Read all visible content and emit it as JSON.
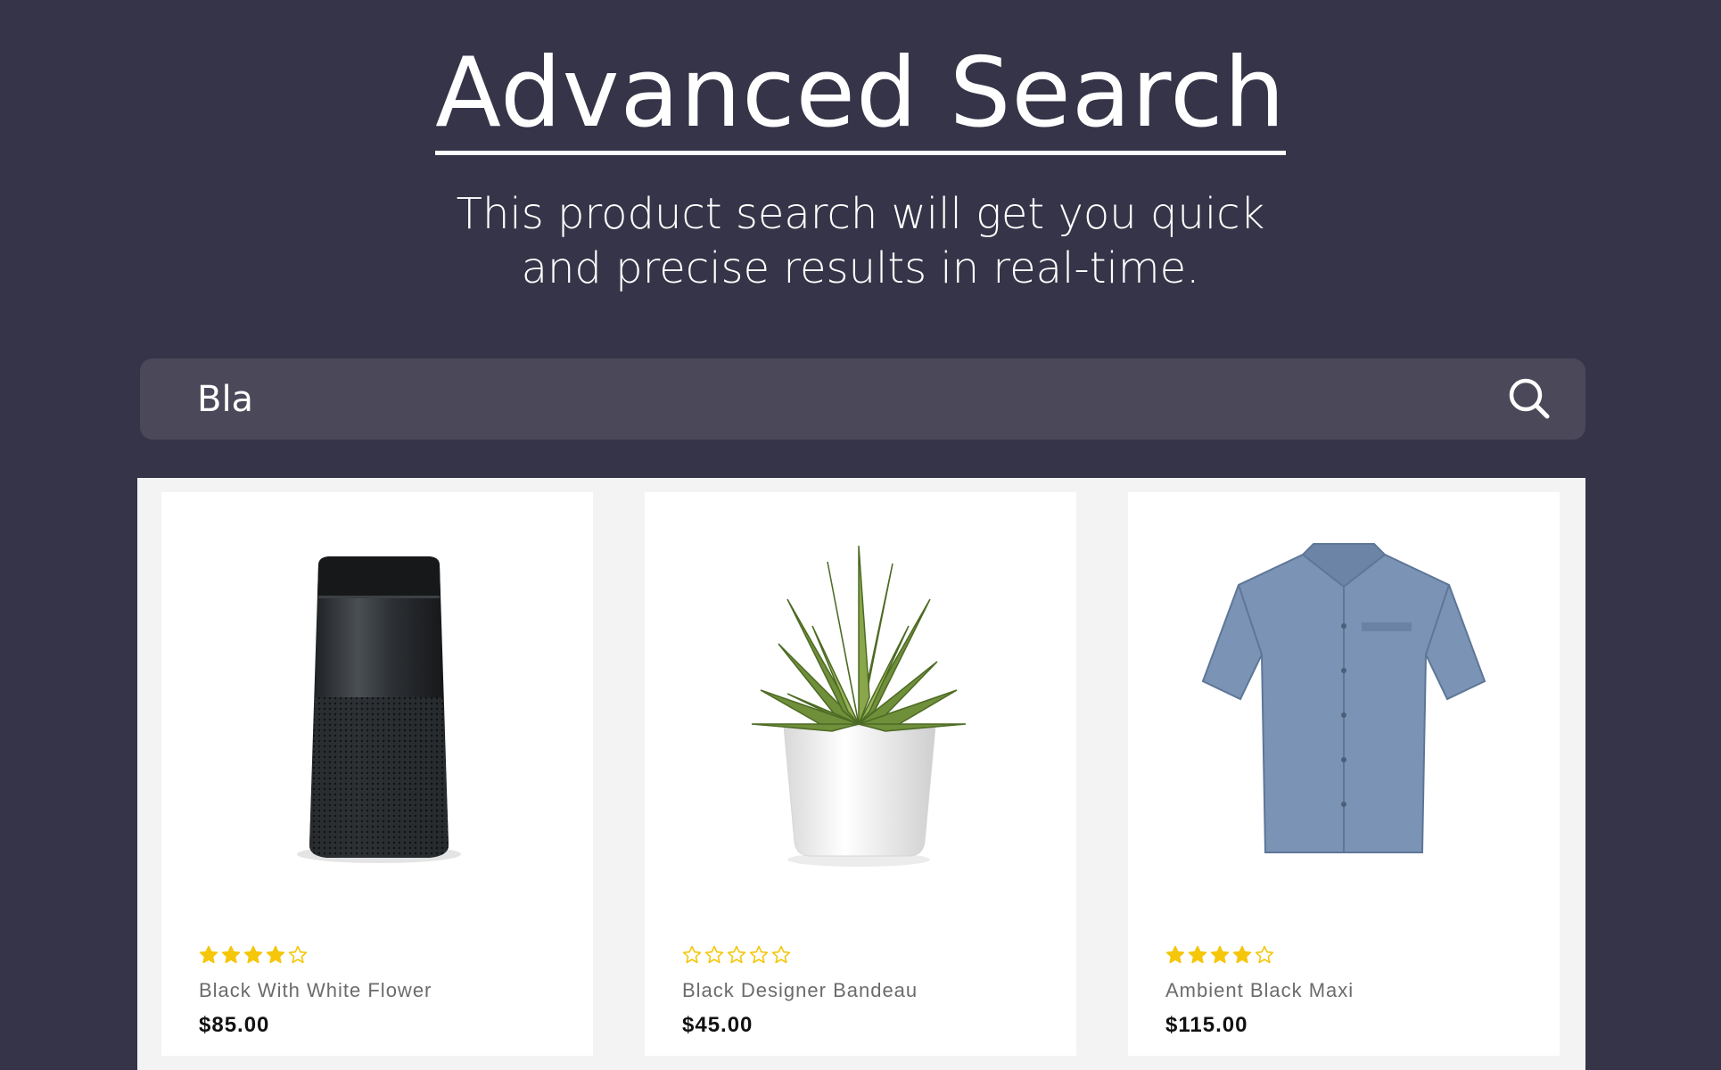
{
  "header": {
    "title": "Advanced Search",
    "subtitle_line1": "This product search will get you quick",
    "subtitle_line2": "and precise results in real-time."
  },
  "search": {
    "value": "Bla",
    "icon": "search-icon"
  },
  "colors": {
    "background": "#363448",
    "search_bar": "#4a4859",
    "star": "#f5c60a",
    "panel": "#f3f3f3"
  },
  "products": [
    {
      "name": "Black With White Flower",
      "price": "$85.00",
      "rating": 4,
      "image": "speaker"
    },
    {
      "name": "Black Designer Bandeau",
      "price": "$45.00",
      "rating": 0,
      "image": "potted-plant"
    },
    {
      "name": "Ambient Black Maxi",
      "price": "$115.00",
      "rating": 4,
      "image": "shirt"
    }
  ]
}
